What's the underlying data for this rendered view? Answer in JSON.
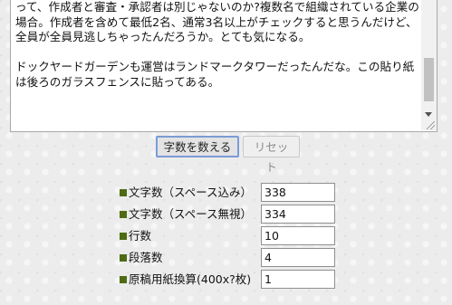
{
  "editor": {
    "text": "って、作成者と審査・承認者は別じゃないのか?複数名で組織されている企業の場合。作成者を含めて最低2名、通常3名以上がチェックすると思うんだけど、全員が全員見逃しちゃったんだろうか。とても気になる。\n\nドックヤードガーデンも運営はランドマークタワーだったんだな。この貼り紙は後ろのガラスフェンスに貼ってある。"
  },
  "buttons": {
    "count": "字数を数える",
    "reset": "リセット"
  },
  "stats": [
    {
      "label": "文字数（スペース込み）",
      "value": "338"
    },
    {
      "label": "文字数（スペース無視）",
      "value": "334"
    },
    {
      "label": "行数",
      "value": "10"
    },
    {
      "label": "段落数",
      "value": "4"
    },
    {
      "label": "原稿用紙換算(400x?枚)",
      "value": "1"
    }
  ],
  "colors": {
    "bullet": "#4e6b12",
    "focus_border": "#7a9cd6"
  }
}
